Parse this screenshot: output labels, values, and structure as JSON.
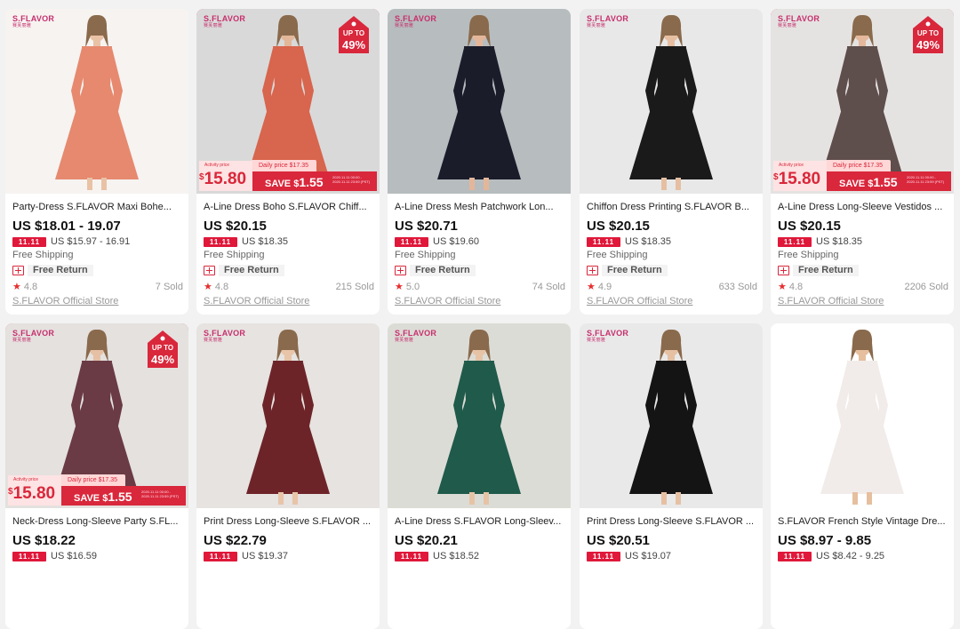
{
  "colors": {
    "accent": "#d9273b",
    "brand": "#c72f6d",
    "background": "#f2f2f2"
  },
  "promo_labels": {
    "up_to": "UP TO",
    "activity_price": "Activity price",
    "daily_price_prefix": "Daily price ",
    "save_prefix": "SAVE ",
    "small_note": "2020.11.11 00:00 - 2020.11.11 23:59 (PST)"
  },
  "labels": {
    "free_shipping": "Free Shipping",
    "free_return": "Free Return",
    "tag": "11.11",
    "brand": "S.FLAVOR",
    "brand_sub": "赛芙丽雅"
  },
  "products": [
    {
      "title": "Party-Dress S.FLAVOR Maxi Bohe...",
      "price": "US $18.01 - 19.07",
      "sale": "US $15.97 - 16.91",
      "rating": "4.8",
      "sold": "7 Sold",
      "store": "S.FLAVOR Official Store",
      "promo": false,
      "brand": true,
      "dress": "#e6896f",
      "bg": "#f6f3f1",
      "skin": "#e9c2a6"
    },
    {
      "title": "A-Line Dress Boho S.FLAVOR Chiff...",
      "price": "US $20.15",
      "sale": "US $18.35",
      "rating": "4.8",
      "sold": "215 Sold",
      "store": "S.FLAVOR Official Store",
      "promo": true,
      "brand": true,
      "upto": "49%",
      "activity": "$15.80",
      "daily": "$17.35",
      "save": "$1.55",
      "dress": "#d8654d",
      "bg": "#d9d9d9",
      "skin": "#e2b79a"
    },
    {
      "title": "A-Line Dress Mesh Patchwork Lon...",
      "price": "US $20.71",
      "sale": "US $19.60",
      "rating": "5.0",
      "sold": "74 Sold",
      "store": "S.FLAVOR Official Store",
      "promo": false,
      "brand": true,
      "dress": "#1b1c2a",
      "bg": "#b7bcbe",
      "skin": "#e3b69a"
    },
    {
      "title": "Chiffon Dress Printing S.FLAVOR B...",
      "price": "US $20.15",
      "sale": "US $18.35",
      "rating": "4.9",
      "sold": "633 Sold",
      "store": "S.FLAVOR Official Store",
      "promo": false,
      "brand": true,
      "dress": "#1a1a1a",
      "bg": "#e8e8e8",
      "skin": "#e6bfa2"
    },
    {
      "title": "A-Line Dress Long-Sleeve Vestidos ...",
      "price": "US $20.15",
      "sale": "US $18.35",
      "rating": "4.8",
      "sold": "2206 Sold",
      "store": "S.FLAVOR Official Store",
      "promo": true,
      "brand": true,
      "upto": "49%",
      "activity": "$15.80",
      "daily": "$17.35",
      "save": "$1.55",
      "dress": "#5e4e4c",
      "bg": "#e5e3e2",
      "skin": "#e3b89c"
    },
    {
      "title": "Neck-Dress Long-Sleeve Party S.FL...",
      "price": "US $18.22",
      "sale": "US $16.59",
      "promo": true,
      "brand": true,
      "upto": "49%",
      "activity": "$15.80",
      "daily": "$17.35",
      "save": "$1.55",
      "dress": "#6a3a45",
      "bg": "#e4e1df",
      "skin": "#e6c0a4"
    },
    {
      "title": "Print Dress Long-Sleeve S.FLAVOR ...",
      "price": "US $22.79",
      "sale": "US $19.37",
      "promo": false,
      "brand": true,
      "dress": "#6d2428",
      "bg": "#e6e3e0",
      "skin": "#e8c4a8"
    },
    {
      "title": "A-Line Dress S.FLAVOR Long-Sleev...",
      "price": "US $20.21",
      "sale": "US $18.52",
      "promo": false,
      "brand": true,
      "dress": "#1f5a4a",
      "bg": "#dcdcd6",
      "skin": "#e7c3a6"
    },
    {
      "title": "Print Dress Long-Sleeve S.FLAVOR ...",
      "price": "US $20.51",
      "sale": "US $19.07",
      "promo": false,
      "brand": true,
      "dress": "#141414",
      "bg": "#e9e9e9",
      "skin": "#e6c0a3"
    },
    {
      "title": "S.FLAVOR French Style Vintage Dre...",
      "price": "US $8.97 - 9.85",
      "sale": "US $8.42 - 9.25",
      "promo": false,
      "brand": false,
      "dress": "#f1ecea",
      "bg": "#ffffff",
      "skin": "#e6bf9f"
    }
  ]
}
